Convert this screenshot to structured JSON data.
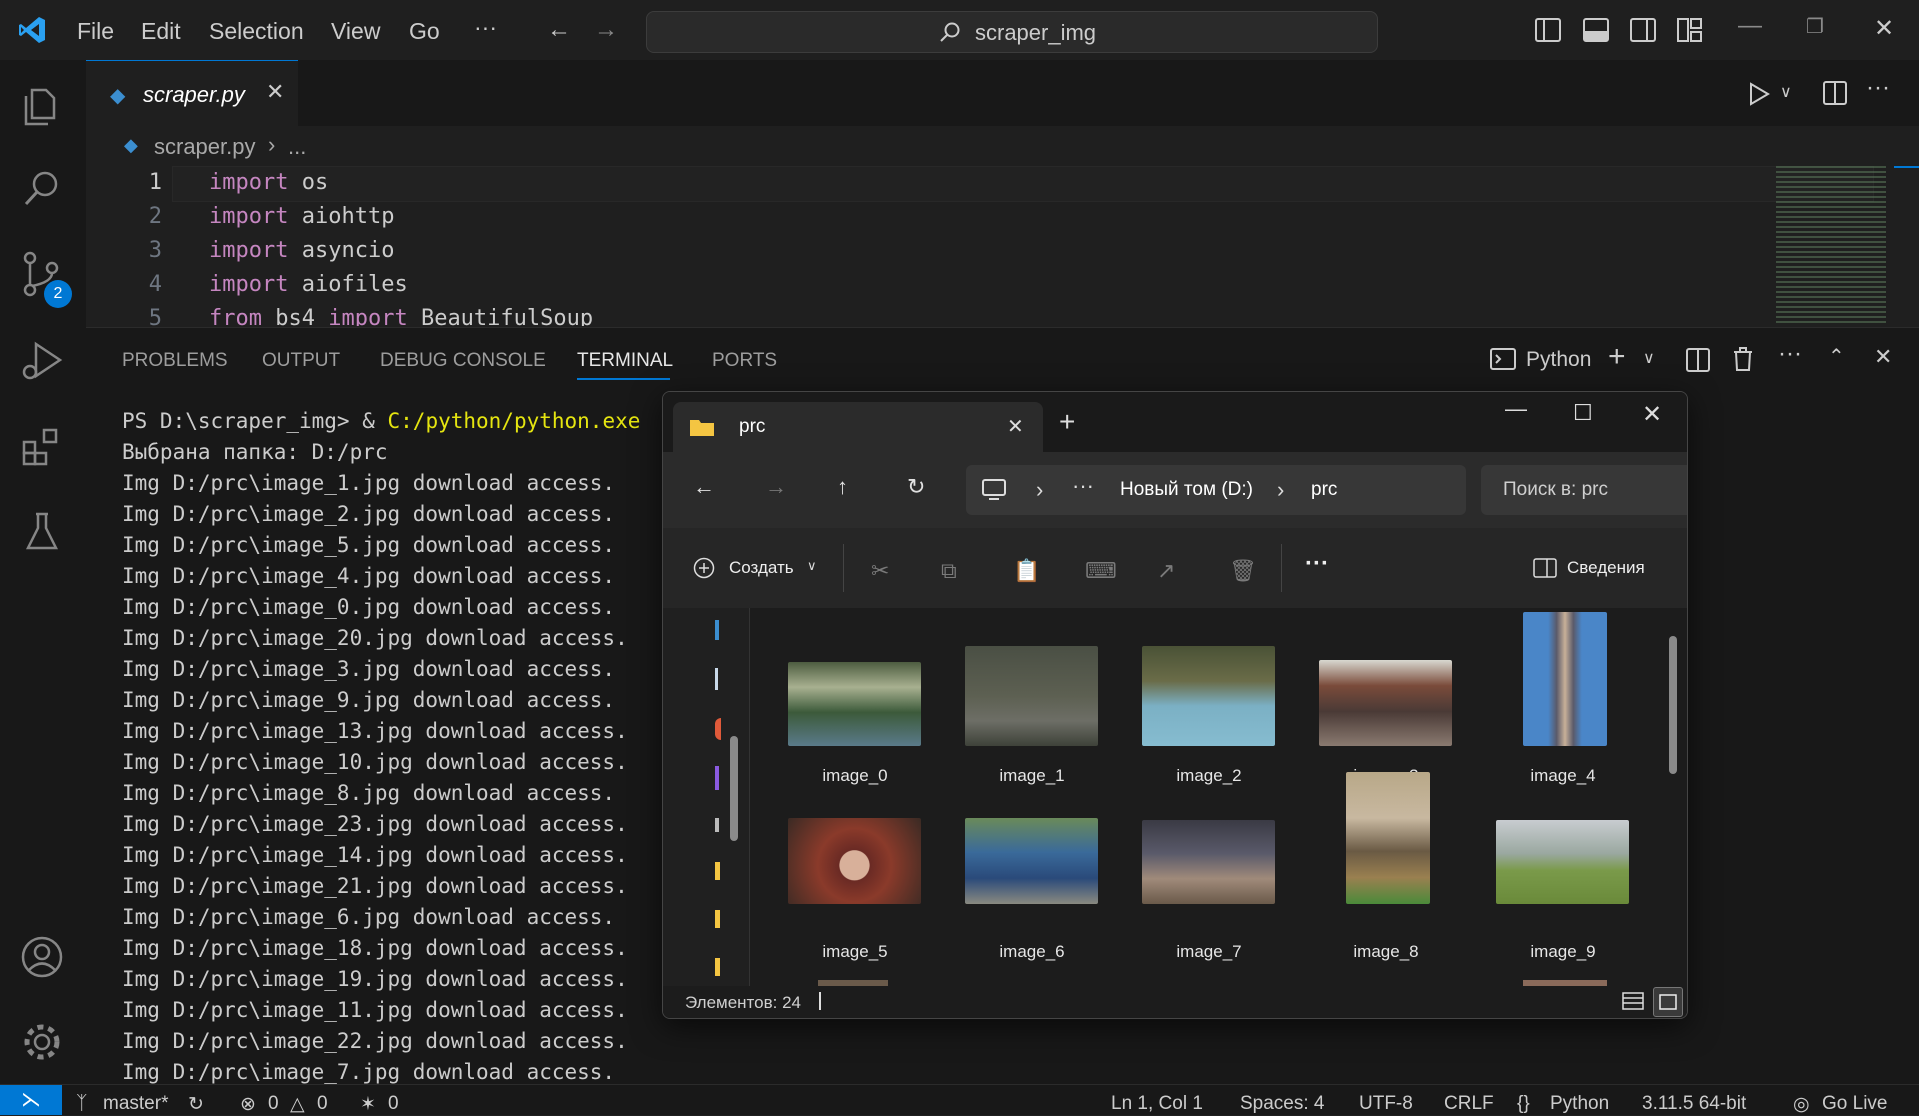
{
  "app": {
    "menu": [
      "File",
      "Edit",
      "Selection",
      "View",
      "Go",
      "···"
    ],
    "search_text": "scraper_img"
  },
  "activity": {
    "scm_badge": "2"
  },
  "editor": {
    "tab_label": "scraper.py",
    "breadcrumb": [
      "scraper.py",
      "..."
    ],
    "lines": [
      {
        "num": "1",
        "kw": "import",
        "rest": " os"
      },
      {
        "num": "2",
        "kw": "import",
        "rest": " aiohttp"
      },
      {
        "num": "3",
        "kw": "import",
        "rest": " asyncio"
      },
      {
        "num": "4",
        "kw": "import",
        "rest": " aiofiles"
      },
      {
        "num": "5",
        "kw": "from",
        "rest": " bs4 ",
        "kw2": "import",
        "rest2": " BeautifulSoup"
      }
    ]
  },
  "panel": {
    "tabs": [
      "PROBLEMS",
      "OUTPUT",
      "DEBUG CONSOLE",
      "TERMINAL",
      "PORTS"
    ],
    "active_tab": "TERMINAL",
    "shell_label": "Python",
    "terminal_prompt": "PS D:\\scraper_img> & ",
    "terminal_cmd": "C:/python/python.exe",
    "terminal_lines": [
      "Выбрана папка: D:/prc",
      "Img D:/prc\\image_1.jpg download access.",
      "Img D:/prc\\image_2.jpg download access.",
      "Img D:/prc\\image_5.jpg download access.",
      "Img D:/prc\\image_4.jpg download access.",
      "Img D:/prc\\image_0.jpg download access.",
      "Img D:/prc\\image_20.jpg download access.",
      "Img D:/prc\\image_3.jpg download access.",
      "Img D:/prc\\image_9.jpg download access.",
      "Img D:/prc\\image_13.jpg download access.",
      "Img D:/prc\\image_10.jpg download access.",
      "Img D:/prc\\image_8.jpg download access.",
      "Img D:/prc\\image_23.jpg download access.",
      "Img D:/prc\\image_14.jpg download access.",
      "Img D:/prc\\image_21.jpg download access.",
      "Img D:/prc\\image_6.jpg download access.",
      "Img D:/prc\\image_18.jpg download access.",
      "Img D:/prc\\image_19.jpg download access.",
      "Img D:/prc\\image_11.jpg download access.",
      "Img D:/prc\\image_22.jpg download access.",
      "Img D:/prc\\image_7.jpg download access."
    ]
  },
  "status": {
    "branch": "master*",
    "errors": "0",
    "warnings": "0",
    "ports": "0",
    "position": "Ln 1, Col 1",
    "spaces": "Spaces: 4",
    "encoding": "UTF-8",
    "eol": "CRLF",
    "language": "Python",
    "interpreter": "3.11.5 64-bit",
    "live": "Go Live"
  },
  "explorer": {
    "tab_title": "prc",
    "address": [
      "Новый том (D:)",
      "prc"
    ],
    "search_placeholder": "Поиск в: prc",
    "create_label": "Создать",
    "details_label": "Сведения",
    "item_count": "Элементов: 24",
    "files": [
      "image_0",
      "image_1",
      "image_2",
      "image_3",
      "image_4",
      "image_5",
      "image_6",
      "image_7",
      "image_8",
      "image_9"
    ]
  }
}
